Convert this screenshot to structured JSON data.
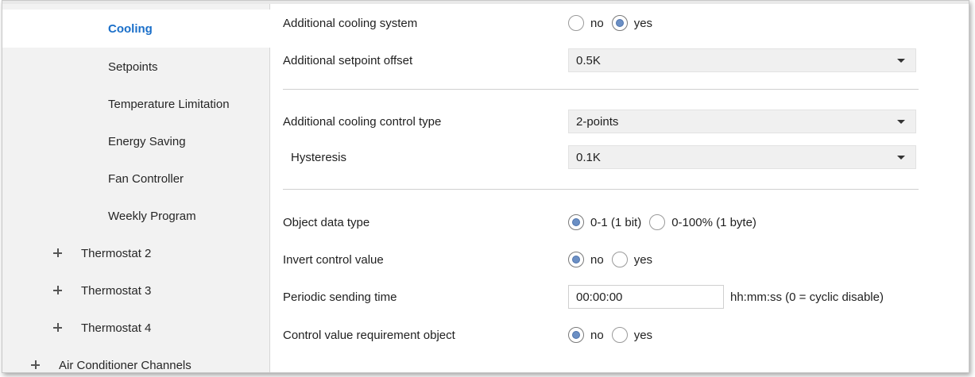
{
  "sidebar": {
    "items": [
      {
        "label": "Cooling",
        "selected": true
      },
      {
        "label": "Setpoints"
      },
      {
        "label": "Temperature Limitation"
      },
      {
        "label": "Energy Saving"
      },
      {
        "label": "Fan Controller"
      },
      {
        "label": "Weekly Program"
      },
      {
        "label": "Thermostat 2",
        "expand_icon": "plus-icon"
      },
      {
        "label": "Thermostat 3",
        "expand_icon": "plus-icon"
      },
      {
        "label": "Thermostat 4",
        "expand_icon": "plus-icon"
      },
      {
        "label": "Air Conditioner Channels",
        "expand_icon": "plus-icon"
      }
    ]
  },
  "form": {
    "additional_cooling_system": {
      "label": "Additional cooling system",
      "options": [
        "no",
        "yes"
      ],
      "selected": "yes"
    },
    "additional_setpoint_offset": {
      "label": "Additional setpoint offset",
      "value": "0.5K"
    },
    "additional_cooling_control_type": {
      "label": "Additional cooling control type",
      "value": "2-points"
    },
    "hysteresis": {
      "label": "Hysteresis",
      "value": "0.1K"
    },
    "object_data_type": {
      "label": "Object data type",
      "options": [
        "0-1 (1 bit)",
        "0-100% (1 byte)"
      ],
      "selected": "0-1 (1 bit)"
    },
    "invert_control_value": {
      "label": "Invert control value",
      "options": [
        "no",
        "yes"
      ],
      "selected": "no"
    },
    "periodic_sending_time": {
      "label": "Periodic sending time",
      "value": "00:00:00",
      "hint": "hh:mm:ss (0 = cyclic disable)"
    },
    "control_value_requirement_object": {
      "label": "Control value requirement object",
      "options": [
        "no",
        "yes"
      ],
      "selected": "no"
    }
  },
  "colors": {
    "selected_text": "#1a6fc9",
    "sidebar_bg": "#f2f2f2",
    "radio_dot": "#6b8fc4"
  }
}
